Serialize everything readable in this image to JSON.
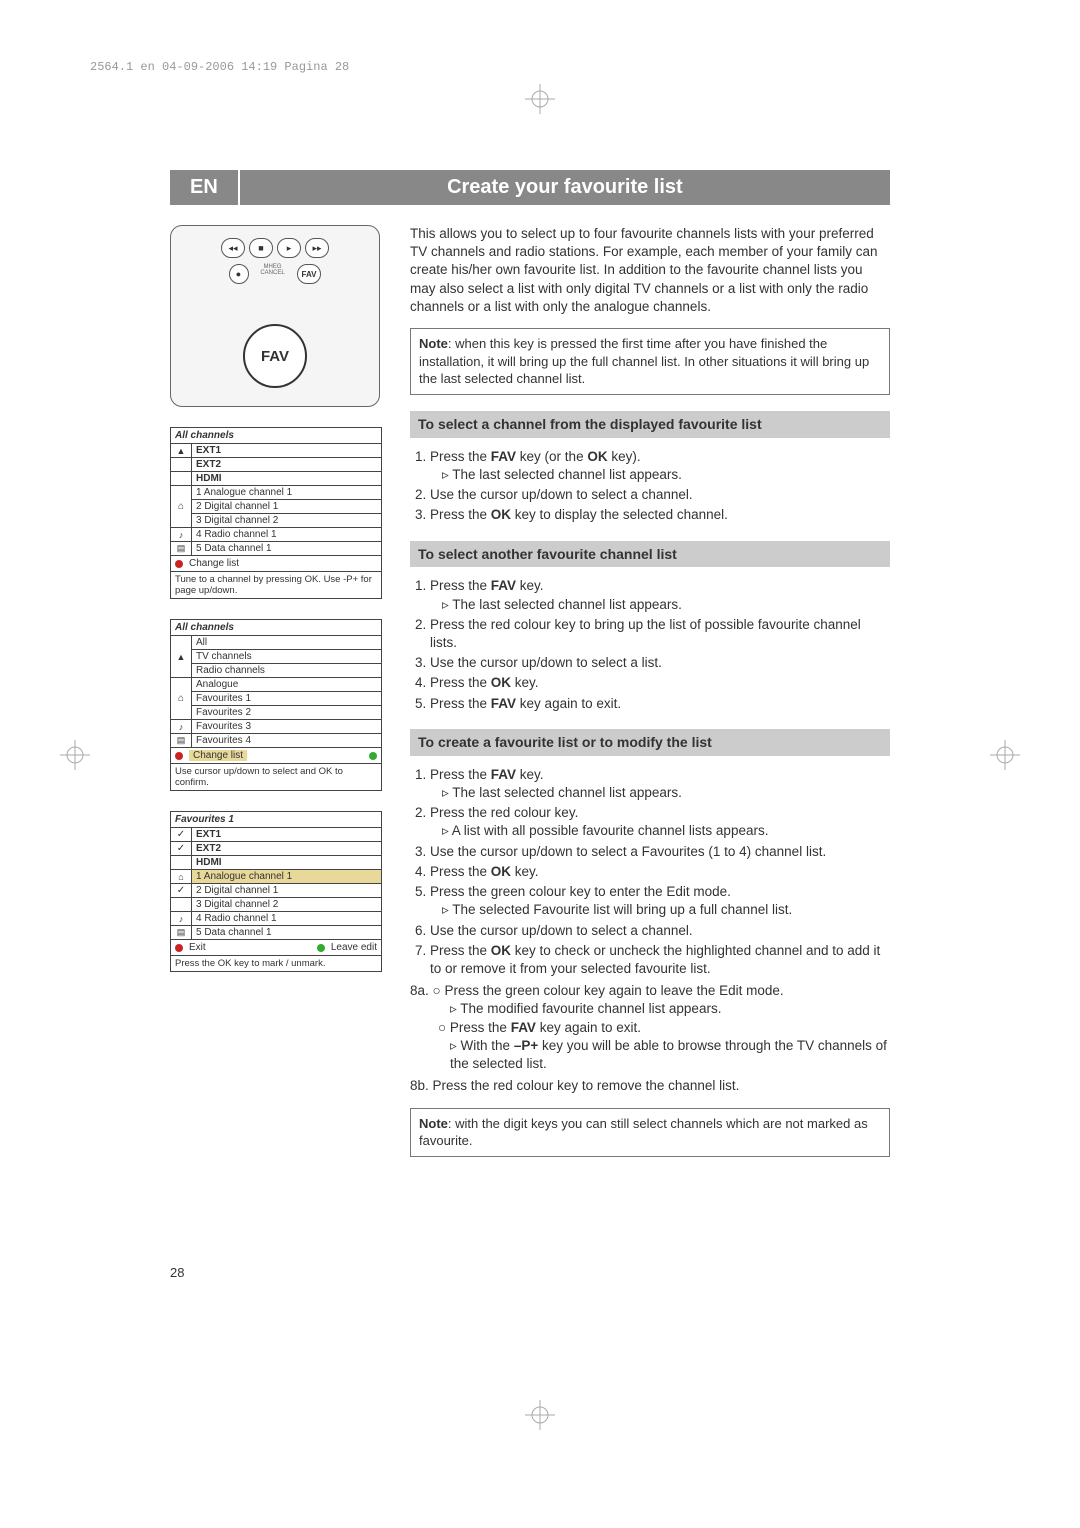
{
  "meta": {
    "header_line": "2564.1 en  04-09-2006  14:19  Pagina 28",
    "page_number": "28"
  },
  "title": {
    "lang": "EN",
    "text": "Create your favourite list"
  },
  "remote": {
    "fav_label": "FAV",
    "fav_small": "FAV"
  },
  "osd1": {
    "title": "All channels",
    "ext1": "EXT1",
    "ext2": "EXT2",
    "hdmi": "HDMI",
    "r1": "1 Analogue channel 1",
    "r2": "2 Digital channel 1",
    "r3": "3 Digital channel 2",
    "r4": "4 Radio channel 1",
    "r5": "5 Data channel 1",
    "change": "Change list",
    "foot": "Tune to a channel by pressing OK. Use -P+ for page up/down."
  },
  "osd2": {
    "title": "All channels",
    "all": "All",
    "tv": "TV channels",
    "radio": "Radio channels",
    "analogue": "Analogue",
    "f1": "Favourites 1",
    "f2": "Favourites 2",
    "f3": "Favourites 3",
    "f4": "Favourites 4",
    "change": "Change list",
    "foot": "Use cursor up/down to select and OK to confirm."
  },
  "osd3": {
    "title": "Favourites 1",
    "ext1": "EXT1",
    "ext2": "EXT2",
    "hdmi": "HDMI",
    "r1": "1 Analogue channel 1",
    "r2": "2 Digital channel 1",
    "r3": "3 Digital channel 2",
    "r4": "4 Radio channel 1",
    "r5": "5 Data channel 1",
    "exit": "Exit",
    "leave": "Leave edit",
    "foot": "Press the OK key to mark / unmark."
  },
  "intro": {
    "p1": "This allows you to select up to four favourite channels lists with your preferred TV channels and radio stations. For example, each member of your family can create his/her own favourite list. In addition to the favourite channel lists you may also select a list with only digital TV channels or a list with only the radio channels or a list with only the analogue channels.",
    "note_label": "Note",
    "note": ": when this key is pressed the first time after you have finished the installation, it will bring up the full channel list. In other situations it will bring up the last selected channel list."
  },
  "sec1": {
    "h": "To select a channel from the displayed favourite list",
    "s1a": "Press the ",
    "s1b": "FAV",
    "s1c": " key (or the ",
    "s1d": "OK",
    "s1e": " key).",
    "s1sub": "The last selected channel list appears.",
    "s2": "Use the cursor up/down to select a channel.",
    "s3a": "Press the ",
    "s3b": "OK",
    "s3c": " key to display the selected channel."
  },
  "sec2": {
    "h": "To select another favourite channel list",
    "s1a": "Press the ",
    "s1b": "FAV",
    "s1c": " key.",
    "s1sub": "The last selected channel list appears.",
    "s2": "Press the red colour key to bring up the list of possible favourite channel lists.",
    "s3": "Use the cursor up/down to select a list.",
    "s4a": "Press the ",
    "s4b": "OK",
    "s4c": " key.",
    "s5a": "Press the ",
    "s5b": "FAV",
    "s5c": " key again to exit."
  },
  "sec3": {
    "h": "To create a favourite list or to modify the list",
    "s1a": "Press the ",
    "s1b": "FAV",
    "s1c": " key.",
    "s1sub": "The last selected channel list appears.",
    "s2": "Press the red colour key.",
    "s2sub": "A list with all possible favourite channel lists appears.",
    "s3": "Use the cursor up/down to select a Favourites (1 to 4) channel list.",
    "s4a": "Press the ",
    "s4b": "OK",
    "s4c": " key.",
    "s5": "Press the green colour key to enter the Edit mode.",
    "s5sub": "The selected Favourite list will bring up a full channel list.",
    "s6": "Use the cursor up/down to select a channel.",
    "s7a": "Press the ",
    "s7b": "OK",
    "s7c": " key to check or uncheck the highlighted channel and to add it to or remove it from your selected favourite list.",
    "s8a_pre": "8a.",
    "s8a_1": "Press the green colour key again to leave the Edit mode.",
    "s8a_1sub": "The modified favourite channel list appears.",
    "s8a_2a": "Press the ",
    "s8a_2b": "FAV",
    "s8a_2c": " key again to exit.",
    "s8a_2suba": "With the ",
    "s8a_2subb": "–P+",
    "s8a_2subc": " key you will be able to browse through the TV channels of the selected list.",
    "s8b": "8b. Press the red colour key to remove the channel list.",
    "note_label": "Note",
    "note": ": with the digit keys you can still select channels which are not marked as favourite."
  }
}
